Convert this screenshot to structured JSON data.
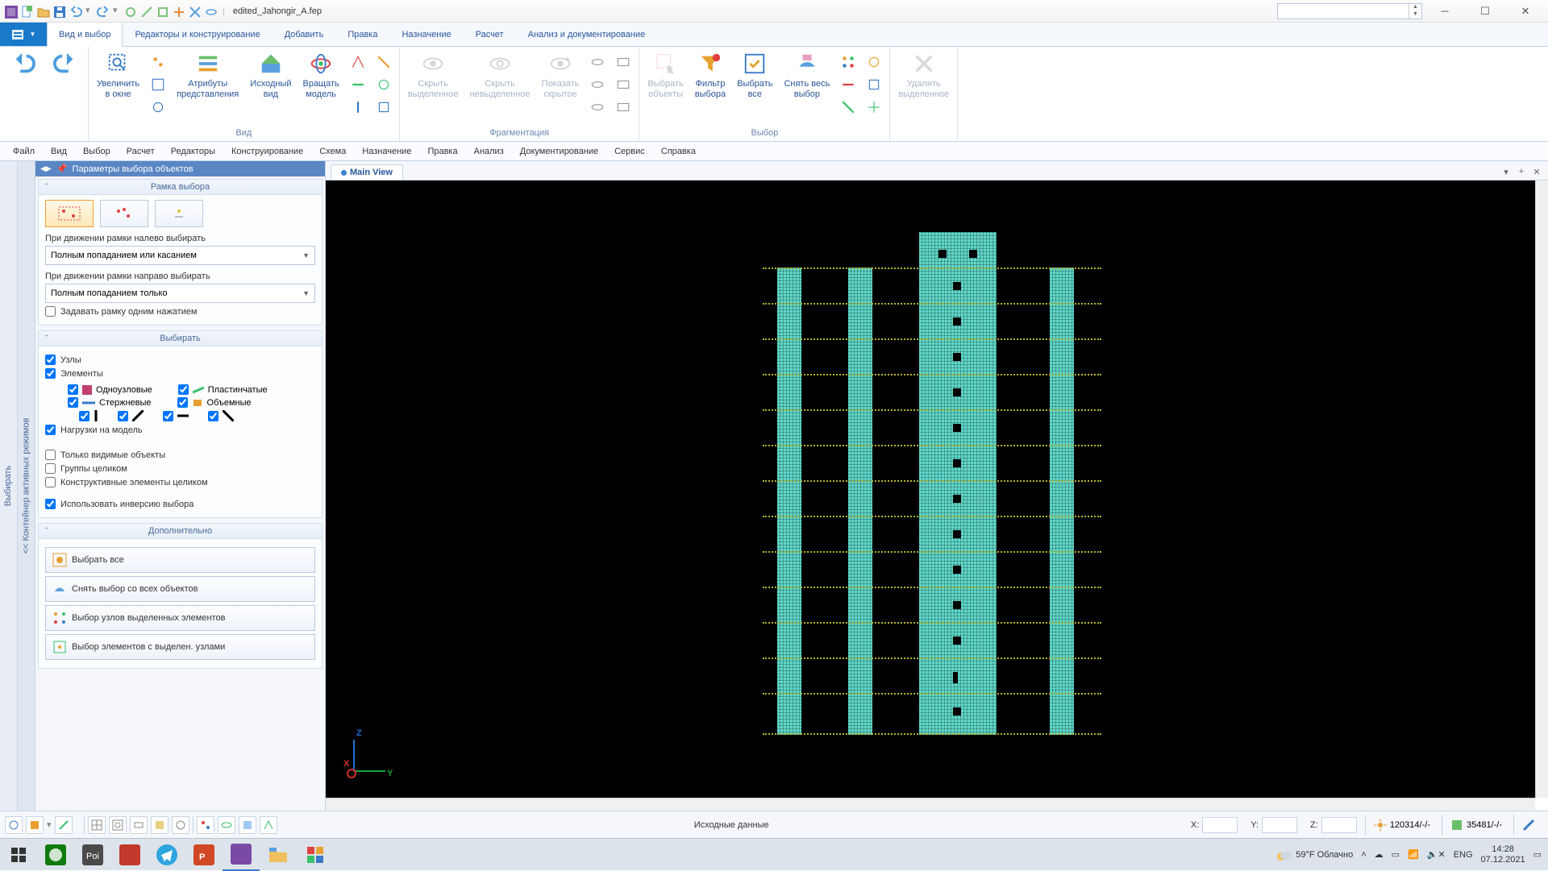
{
  "title": {
    "doc": "edited_Jahongir_A.fep"
  },
  "ribbonTabs": {
    "file": "",
    "t0": "Вид и выбор",
    "t1": "Редакторы и конструирование",
    "t2": "Добавить",
    "t3": "Правка",
    "t4": "Назначение",
    "t5": "Расчет",
    "t6": "Анализ и документирование"
  },
  "ribbon": {
    "g0": {
      "undo": "",
      "redo": ""
    },
    "g1": {
      "label": "Вид",
      "b0": "Увеличить\nв окне",
      "b1": "Атрибуты\nпредставления",
      "b2": "Исходный\nвид",
      "b3": "Вращать\nмодель"
    },
    "g2": {
      "label": "Фрагментация",
      "b0": "Скрыть\nвыделенное",
      "b1": "Скрыть\nневыделенное",
      "b2": "Показать\nскрытое"
    },
    "g3": {
      "label": "Выбор",
      "b0": "Выбрать\nобъекты",
      "b1": "Фильтр\nвыбора",
      "b2": "Выбрать\nвсе",
      "b3": "Снять весь\nвыбор"
    },
    "g4": {
      "b0": "Удалить\nвыделенное"
    }
  },
  "menubar": {
    "m0": "Файл",
    "m1": "Вид",
    "m2": "Выбор",
    "m3": "Расчет",
    "m4": "Редакторы",
    "m5": "Конструирование",
    "m6": "Схема",
    "m7": "Назначение",
    "m8": "Правка",
    "m9": "Анализ",
    "m10": "Документирование",
    "m11": "Сервис",
    "m12": "Справка"
  },
  "sidebar": {
    "vlabel1": "Выбирать",
    "vlabel2": "<< Контейнер активных режимов",
    "title": "Параметры выбора объектов",
    "sec0": {
      "h": "Рамка выбора",
      "leftLabel": "При движении рамки налево выбирать",
      "leftDrop": "Полным попаданием или касанием",
      "rightLabel": "При движении рамки направо выбирать",
      "rightDrop": "Полным попаданием только",
      "oneClick": "Задавать рамку одним нажатием"
    },
    "sec1": {
      "h": "Выбирать",
      "nodes": "Узлы",
      "elements": "Элементы",
      "single": "Одноузловые",
      "plate": "Пластинчатые",
      "bar": "Стержневые",
      "solid": "Объемные",
      "loads": "Нагрузки на модель",
      "visible": "Только видимые объекты",
      "groups": "Группы целиком",
      "constr": "Конструктивные элементы целиком",
      "inverse": "Использовать инверсию выбора"
    },
    "sec2": {
      "h": "Дополнительно",
      "a0": "Выбрать все",
      "a1": "Снять выбор со всех объектов",
      "a2": "Выбор узлов выделенных элементов",
      "a3": "Выбор элементов с выделен. узлами"
    }
  },
  "viewport": {
    "tab": "Main View"
  },
  "status": {
    "mid": "Исходные данные",
    "x": "X:",
    "y": "Y:",
    "z": "Z:",
    "info1": "120314/-/-",
    "info2": "35481/-/-"
  },
  "tray": {
    "weather": "59°F Облачно",
    "lang": "ENG",
    "time": "14:28",
    "date": "07.12.2021"
  }
}
